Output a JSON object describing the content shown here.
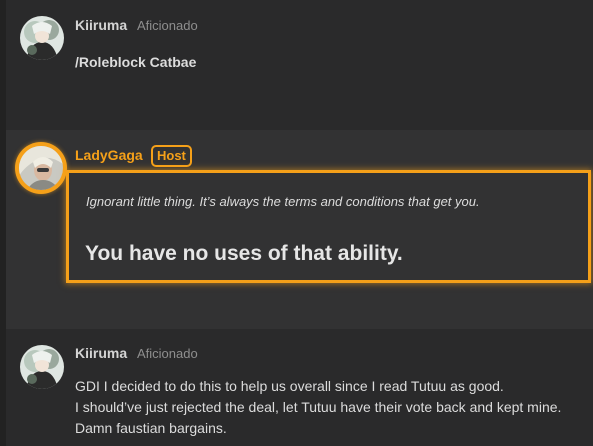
{
  "posts": [
    {
      "author": "Kiiruma",
      "role": "Aficionado",
      "avatar_icon": "anime-character-avatar",
      "message": "/Roleblock Catbae"
    },
    {
      "author": "LadyGaga",
      "badge": "Host",
      "avatar_icon": "lady-gaga-avatar",
      "accent_color": "#f5a019",
      "quote": "Ignorant little thing. It’s always the terms and conditions that get you.",
      "result": "You have no uses of that ability."
    },
    {
      "author": "Kiiruma",
      "role": "Aficionado",
      "avatar_icon": "anime-character-avatar",
      "lines": [
        "GDI I decided to do this to help us overall since I read Tutuu as good.",
        "I should’ve just rejected the deal, let Tutuu have their vote back and kept mine.",
        "Damn faustian bargains."
      ]
    }
  ]
}
